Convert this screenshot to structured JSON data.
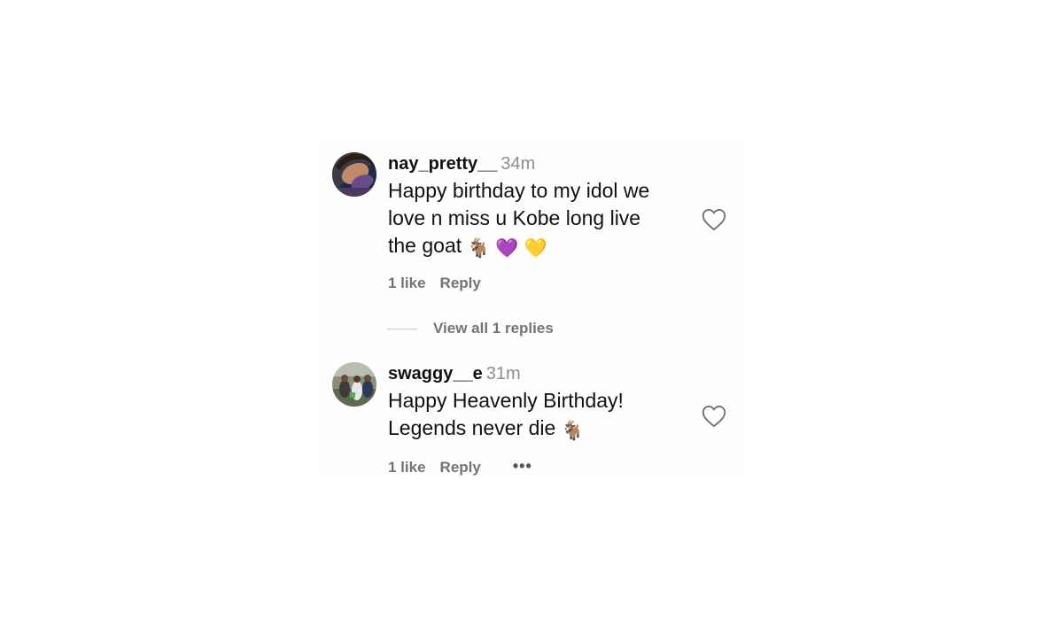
{
  "comments": [
    {
      "username": "nay_pretty__",
      "time": "34m",
      "text_lines": [
        "Happy birthday to my idol we",
        "love n miss u Kobe long live",
        "the goat"
      ],
      "emojis": [
        "🐐",
        "💜",
        "💛"
      ],
      "likes": "1 like",
      "reply_label": "Reply"
    },
    {
      "username": "swaggy__e",
      "time": "31m",
      "text_lines": [
        "Happy Heavenly Birthday!",
        "Legends never die"
      ],
      "emojis": [
        "🐐"
      ],
      "likes": "1 like",
      "reply_label": "Reply",
      "more_label": "•••"
    }
  ],
  "view_replies_label": "View all 1 replies",
  "icons": {
    "like": "heart-outline-icon",
    "more": "more-options-icon"
  },
  "colors": {
    "meta_gray": "#8e8e8e",
    "action_gray": "#737373",
    "heart_stroke": "#737373"
  }
}
